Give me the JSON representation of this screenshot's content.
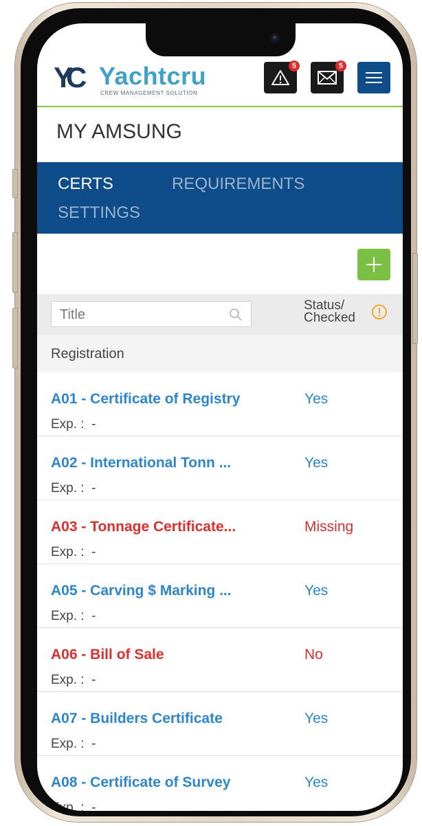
{
  "header": {
    "logo_mark": "YC",
    "logo_name": "Yachtcru",
    "logo_tagline": "CREW MANAGEMENT SOLUTION",
    "alerts_count": "5",
    "messages_count": "5",
    "icons": {
      "alerts": "warning-icon",
      "messages": "mail-icon",
      "menu": "hamburger-icon"
    }
  },
  "page": {
    "title": "MY AMSUNG"
  },
  "tabs": [
    {
      "label": "CERTS",
      "active": true
    },
    {
      "label": "REQUIREMENTS",
      "active": false
    },
    {
      "label": "SETTINGS",
      "active": false
    }
  ],
  "filter": {
    "search_placeholder": "Title",
    "status_header_line1": "Status/",
    "status_header_line2": "Checked"
  },
  "group": {
    "label": "Registration"
  },
  "certs": [
    {
      "title": "A01 - Certificate of Registry",
      "status": "Yes",
      "exp_label": "Exp. :",
      "exp_value": "-",
      "state": "ok"
    },
    {
      "title": "A02 - International Tonn ...",
      "status": "Yes",
      "exp_label": "Exp. :",
      "exp_value": "-",
      "state": "ok"
    },
    {
      "title": "A03 - Tonnage Certificate...",
      "status": "Missing",
      "exp_label": "Exp. :",
      "exp_value": "-",
      "state": "bad"
    },
    {
      "title": "A05 - Carving $ Marking ...",
      "status": "Yes",
      "exp_label": "Exp. :",
      "exp_value": "-",
      "state": "ok"
    },
    {
      "title": "A06 - Bill of Sale",
      "status": "No",
      "exp_label": "Exp. :",
      "exp_value": "-",
      "state": "bad"
    },
    {
      "title": "A07 - Builders Certificate",
      "status": "Yes",
      "exp_label": "Exp. :",
      "exp_value": "-",
      "state": "ok"
    },
    {
      "title": "A08 - Certificate of Survey",
      "status": "Yes",
      "exp_label": "Exp. :",
      "exp_value": "-",
      "state": "ok"
    }
  ],
  "colors": {
    "nav_blue": "#0f4c8a",
    "accent_green": "#7ac143",
    "link_blue": "#2d86cc",
    "error_red": "#d9302e",
    "warning_orange": "#f5a623"
  }
}
